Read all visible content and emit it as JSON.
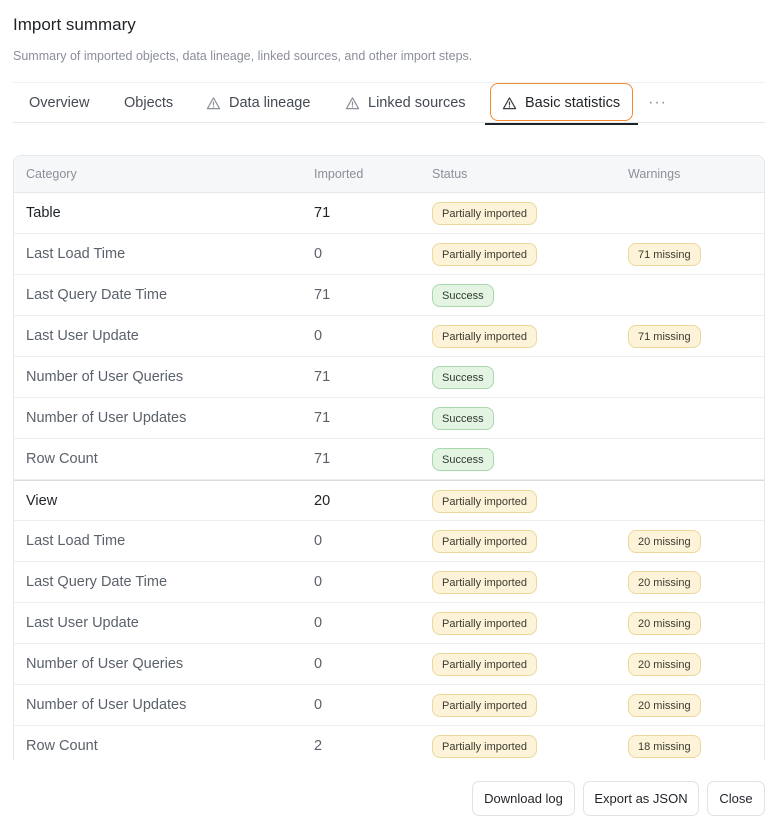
{
  "dialog": {
    "title": "Import summary",
    "subtitle": "Summary of imported objects, data lineage, linked sources, and other import steps."
  },
  "tabs": [
    {
      "label": "Overview",
      "warning": false,
      "active": false
    },
    {
      "label": "Objects",
      "warning": false,
      "active": false
    },
    {
      "label": "Data lineage",
      "warning": true,
      "active": false
    },
    {
      "label": "Linked sources",
      "warning": true,
      "active": false
    },
    {
      "label": "Basic statistics",
      "warning": true,
      "active": true
    },
    {
      "label": "···",
      "warning": false,
      "active": false
    }
  ],
  "table": {
    "headers": [
      "Category",
      "Imported",
      "Status",
      "Warnings"
    ],
    "rows": [
      {
        "category": "Table",
        "imported": "71",
        "status": "Partially imported",
        "status_type": "partial",
        "warning": "",
        "group": true
      },
      {
        "category": "Last Load Time",
        "imported": "0",
        "status": "Partially imported",
        "status_type": "partial",
        "warning": "71 missing",
        "group": false
      },
      {
        "category": "Last Query Date Time",
        "imported": "71",
        "status": "Success",
        "status_type": "success",
        "warning": "",
        "group": false
      },
      {
        "category": "Last User Update",
        "imported": "0",
        "status": "Partially imported",
        "status_type": "partial",
        "warning": "71 missing",
        "group": false
      },
      {
        "category": "Number of User Queries",
        "imported": "71",
        "status": "Success",
        "status_type": "success",
        "warning": "",
        "group": false
      },
      {
        "category": "Number of User Updates",
        "imported": "71",
        "status": "Success",
        "status_type": "success",
        "warning": "",
        "group": false
      },
      {
        "category": "Row Count",
        "imported": "71",
        "status": "Success",
        "status_type": "success",
        "warning": "",
        "group": false
      },
      {
        "category": "View",
        "imported": "20",
        "status": "Partially imported",
        "status_type": "partial",
        "warning": "",
        "group": true
      },
      {
        "category": "Last Load Time",
        "imported": "0",
        "status": "Partially imported",
        "status_type": "partial",
        "warning": "20 missing",
        "group": false
      },
      {
        "category": "Last Query Date Time",
        "imported": "0",
        "status": "Partially imported",
        "status_type": "partial",
        "warning": "20 missing",
        "group": false
      },
      {
        "category": "Last User Update",
        "imported": "0",
        "status": "Partially imported",
        "status_type": "partial",
        "warning": "20 missing",
        "group": false
      },
      {
        "category": "Number of User Queries",
        "imported": "0",
        "status": "Partially imported",
        "status_type": "partial",
        "warning": "20 missing",
        "group": false
      },
      {
        "category": "Number of User Updates",
        "imported": "0",
        "status": "Partially imported",
        "status_type": "partial",
        "warning": "20 missing",
        "group": false
      },
      {
        "category": "Row Count",
        "imported": "2",
        "status": "Partially imported",
        "status_type": "partial",
        "warning": "18 missing",
        "group": false
      }
    ]
  },
  "footer": {
    "download_log": "Download log",
    "export_json": "Export as JSON",
    "close": "Close"
  },
  "colors": {
    "focus_ring": "#f08a34",
    "partial_bg": "#fcf3d9",
    "success_bg": "#e3f4e3"
  }
}
